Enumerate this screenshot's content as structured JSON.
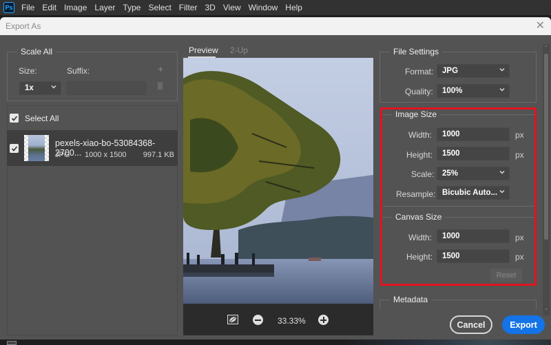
{
  "app": {
    "logo_text": "Ps",
    "menu": [
      "File",
      "Edit",
      "Image",
      "Layer",
      "Type",
      "Select",
      "Filter",
      "3D",
      "View",
      "Window",
      "Help"
    ]
  },
  "dialog": {
    "title": "Export As",
    "close_icon": "close-icon"
  },
  "scale_all": {
    "title": "Scale All",
    "size_label": "Size:",
    "suffix_label": "Suffix:",
    "size_value": "1x",
    "suffix_value": "",
    "add_icon": "plus-icon",
    "delete_icon": "trash-icon"
  },
  "assets": {
    "select_all_label": "Select All",
    "select_all_checked": true,
    "items": [
      {
        "name": "pexels-xiao-bo-53084368-2700...",
        "format": "JPG",
        "dimensions": "1000 x 1500",
        "size": "997.1 KB",
        "checked": true
      }
    ]
  },
  "preview": {
    "tabs": [
      {
        "label": "Preview",
        "active": true
      },
      {
        "label": "2-Up",
        "active": false
      }
    ],
    "zoom": "33.33%",
    "fit_icon": "fit-to-screen-icon",
    "zoom_out_icon": "zoom-out-icon",
    "zoom_in_icon": "zoom-in-icon"
  },
  "file_settings": {
    "title": "File Settings",
    "format_label": "Format:",
    "format_value": "JPG",
    "quality_label": "Quality:",
    "quality_value": "100%"
  },
  "image_size": {
    "title": "Image Size",
    "width_label": "Width:",
    "width_value": "1000",
    "height_label": "Height:",
    "height_value": "1500",
    "scale_label": "Scale:",
    "scale_value": "25%",
    "resample_label": "Resample:",
    "resample_value": "Bicubic Auto...",
    "unit": "px"
  },
  "canvas_size": {
    "title": "Canvas Size",
    "width_label": "Width:",
    "width_value": "1000",
    "height_label": "Height:",
    "height_value": "1500",
    "unit": "px",
    "reset_label": "Reset"
  },
  "metadata": {
    "title": "Metadata"
  },
  "actions": {
    "cancel_label": "Cancel",
    "export_label": "Export"
  },
  "colors": {
    "accent": "#1473e6",
    "highlight": "#e0141e",
    "panel": "#535353"
  }
}
